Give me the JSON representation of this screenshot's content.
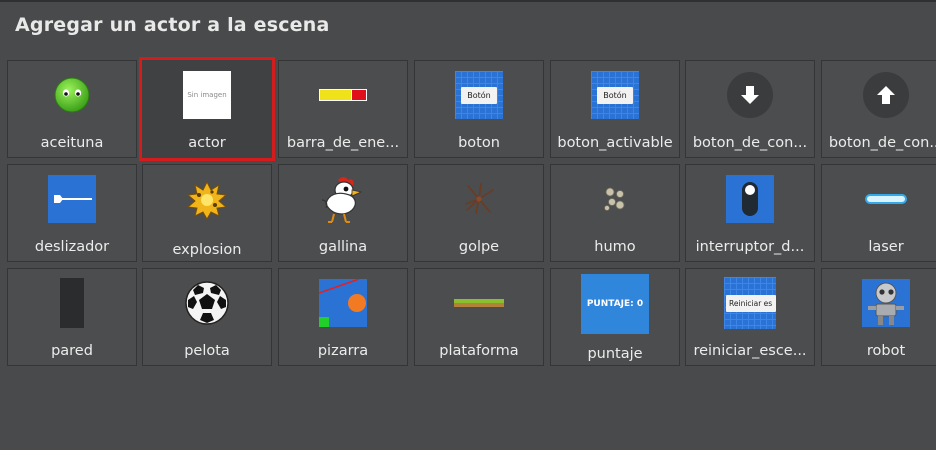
{
  "dialog": {
    "title": "Agregar un actor a la escena"
  },
  "actors": [
    {
      "label": "aceituna",
      "icon": "olive-icon"
    },
    {
      "label": "actor",
      "icon": "no-image-icon",
      "thumb_text": "Sin imagen",
      "selected": true
    },
    {
      "label": "barra_de_ene...",
      "icon": "energy-bar-icon"
    },
    {
      "label": "boton",
      "icon": "button-icon",
      "thumb_text": "Botón"
    },
    {
      "label": "boton_activable",
      "icon": "toggle-button-icon",
      "thumb_text": "Botón"
    },
    {
      "label": "boton_de_con...",
      "icon": "arrow-down-button-icon"
    },
    {
      "label": "boton_de_con...",
      "icon": "arrow-up-button-icon"
    },
    {
      "label": "deslizador",
      "icon": "slider-icon"
    },
    {
      "label": "explosion",
      "icon": "explosion-icon"
    },
    {
      "label": "gallina",
      "icon": "chicken-icon"
    },
    {
      "label": "golpe",
      "icon": "hit-icon"
    },
    {
      "label": "humo",
      "icon": "smoke-icon"
    },
    {
      "label": "interruptor_d...",
      "icon": "switch-icon"
    },
    {
      "label": "laser",
      "icon": "laser-icon"
    },
    {
      "label": "pared",
      "icon": "wall-icon"
    },
    {
      "label": "pelota",
      "icon": "soccer-ball-icon"
    },
    {
      "label": "pizarra",
      "icon": "blackboard-icon"
    },
    {
      "label": "plataforma",
      "icon": "platform-icon"
    },
    {
      "label": "puntaje",
      "icon": "score-icon",
      "thumb_text": "PUNTAJE: 0"
    },
    {
      "label": "reiniciar_esce...",
      "icon": "restart-scene-icon",
      "thumb_text": "Reiniciar es"
    },
    {
      "label": "robot",
      "icon": "robot-icon"
    }
  ],
  "colors": {
    "background": "#484a4b",
    "tile": "#4b4d4e",
    "selected_border": "#d31c1c",
    "blue": "#2a73d5"
  }
}
